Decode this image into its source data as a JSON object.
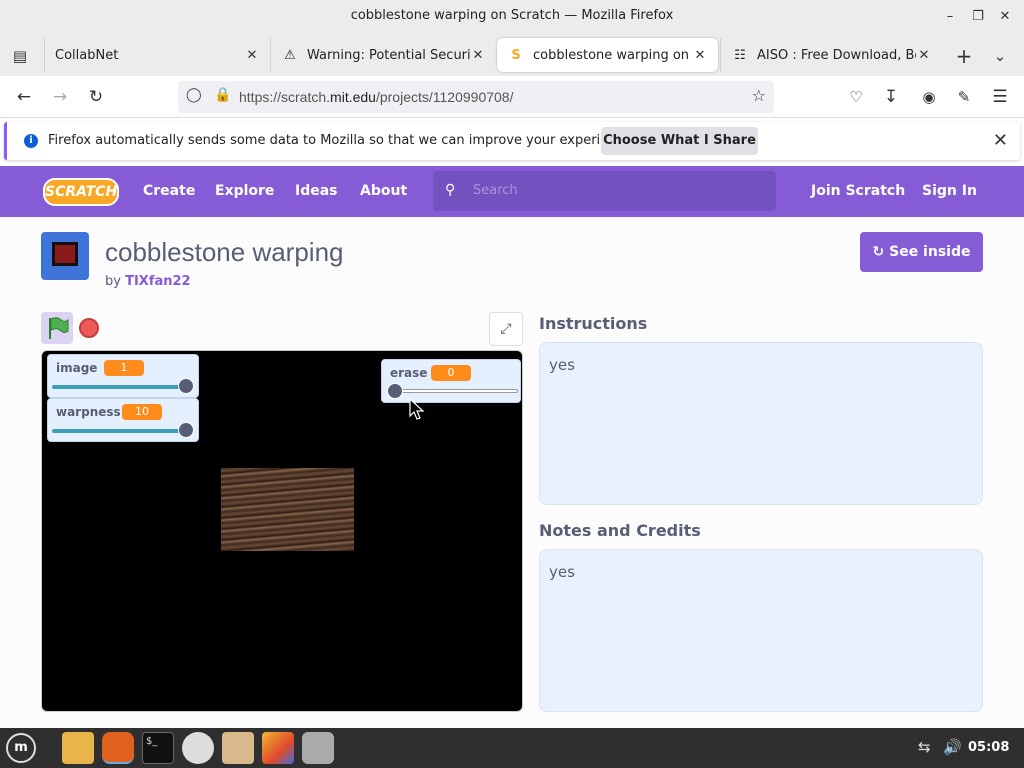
{
  "window": {
    "title": "cobblestone warping on Scratch — Mozilla Firefox"
  },
  "tabs": [
    {
      "label": "CollabNet"
    },
    {
      "label": "Warning: Potential Security Risk"
    },
    {
      "label": "cobblestone warping on Scratch"
    },
    {
      "label": "AISO : Free Download, Borrow"
    }
  ],
  "address": {
    "url_prefix": "https://scratch.",
    "url_domain": "mit.edu",
    "url_suffix": "/projects/1120990708/"
  },
  "notification": {
    "message": "Firefox automatically sends some data to Mozilla so that we can improve your experience.",
    "button": "Choose What I Share"
  },
  "scratch": {
    "logo": "SCRATCH",
    "nav": {
      "create": "Create",
      "explore": "Explore",
      "ideas": "Ideas",
      "about": "About"
    },
    "search_placeholder": "Search",
    "join": "Join Scratch",
    "signin": "Sign In"
  },
  "project": {
    "title": "cobblestone warping",
    "by_prefix": "by",
    "author": "TIXfan22",
    "see_inside": "See inside"
  },
  "monitors": {
    "image": {
      "name": "image",
      "value": "1"
    },
    "warpness": {
      "name": "warpness",
      "value": "10"
    },
    "erase": {
      "name": "erase",
      "value": "0"
    }
  },
  "instructions": {
    "heading": "Instructions",
    "text": "yes"
  },
  "notes": {
    "heading": "Notes and Credits",
    "text": "yes"
  },
  "taskbar": {
    "time": "05:08"
  },
  "colors": {
    "scratch_purple": "#855cd6",
    "monitor_orange": "#ff8c1a"
  }
}
